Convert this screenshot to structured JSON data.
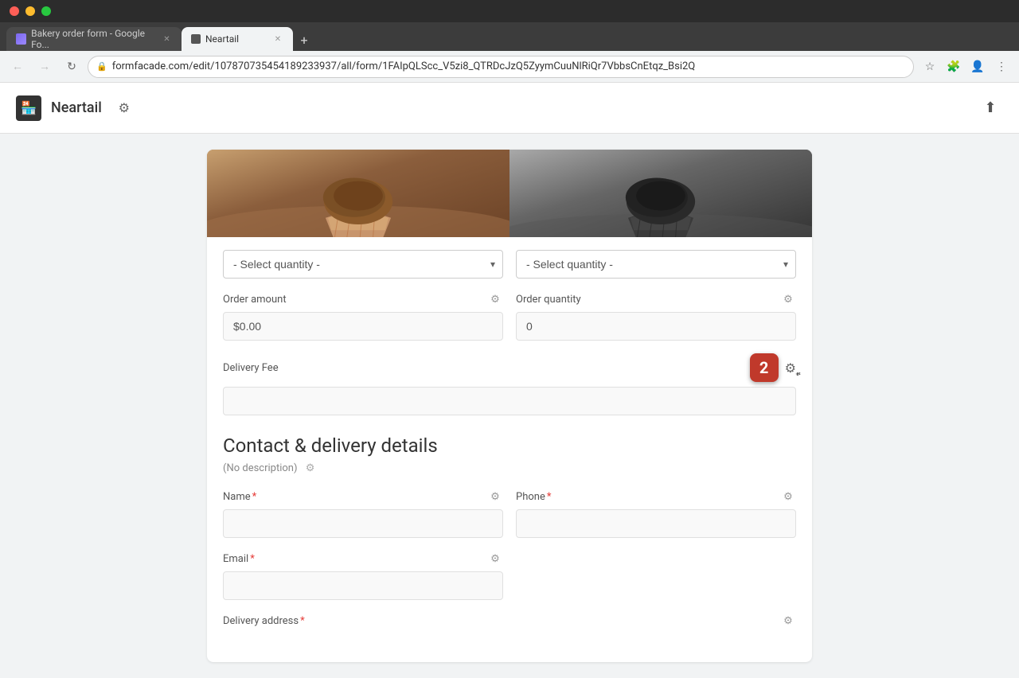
{
  "os": {
    "traffic_lights": [
      "red",
      "yellow",
      "green"
    ]
  },
  "browser": {
    "tabs": [
      {
        "id": "tab-google-forms",
        "label": "Bakery order form - Google Fo...",
        "favicon_type": "google-forms",
        "active": false
      },
      {
        "id": "tab-neartail",
        "label": "Neartail",
        "favicon_type": "neartail",
        "active": true
      }
    ],
    "address_bar": {
      "url": "formfacade.com/edit/107870735454189233937/all/form/1FAIpQLScc_V5zi8_QTRDcJzQ5ZyymCuuNlRiQr7VbbsCnEtqz_Bsi2Q",
      "lock_icon": "🔒"
    }
  },
  "header": {
    "logo_icon": "🏪",
    "title": "Neartail",
    "settings_icon": "⚙",
    "share_icon": "↗"
  },
  "form": {
    "left_quantity_placeholder": "- Select quantity -",
    "right_quantity_placeholder": "- Select quantity -",
    "order_amount_label": "Order amount",
    "order_amount_value": "$0.00",
    "order_quantity_label": "Order quantity",
    "order_quantity_value": "0",
    "delivery_fee_label": "Delivery Fee",
    "delivery_fee_value": "",
    "contact_section_title": "Contact & delivery details",
    "contact_section_desc": "(No description)",
    "name_label": "Name",
    "phone_label": "Phone",
    "email_label": "Email",
    "delivery_address_label": "Delivery address",
    "required_marker": "*",
    "badge_number": "2"
  },
  "icons": {
    "gear": "⚙",
    "chevron_down": "▾",
    "lock": "🔒",
    "back": "←",
    "forward": "→",
    "refresh": "↻",
    "star": "☆",
    "extension": "🧩",
    "avatar": "👤",
    "menu": "⋮",
    "share": "⬆"
  }
}
